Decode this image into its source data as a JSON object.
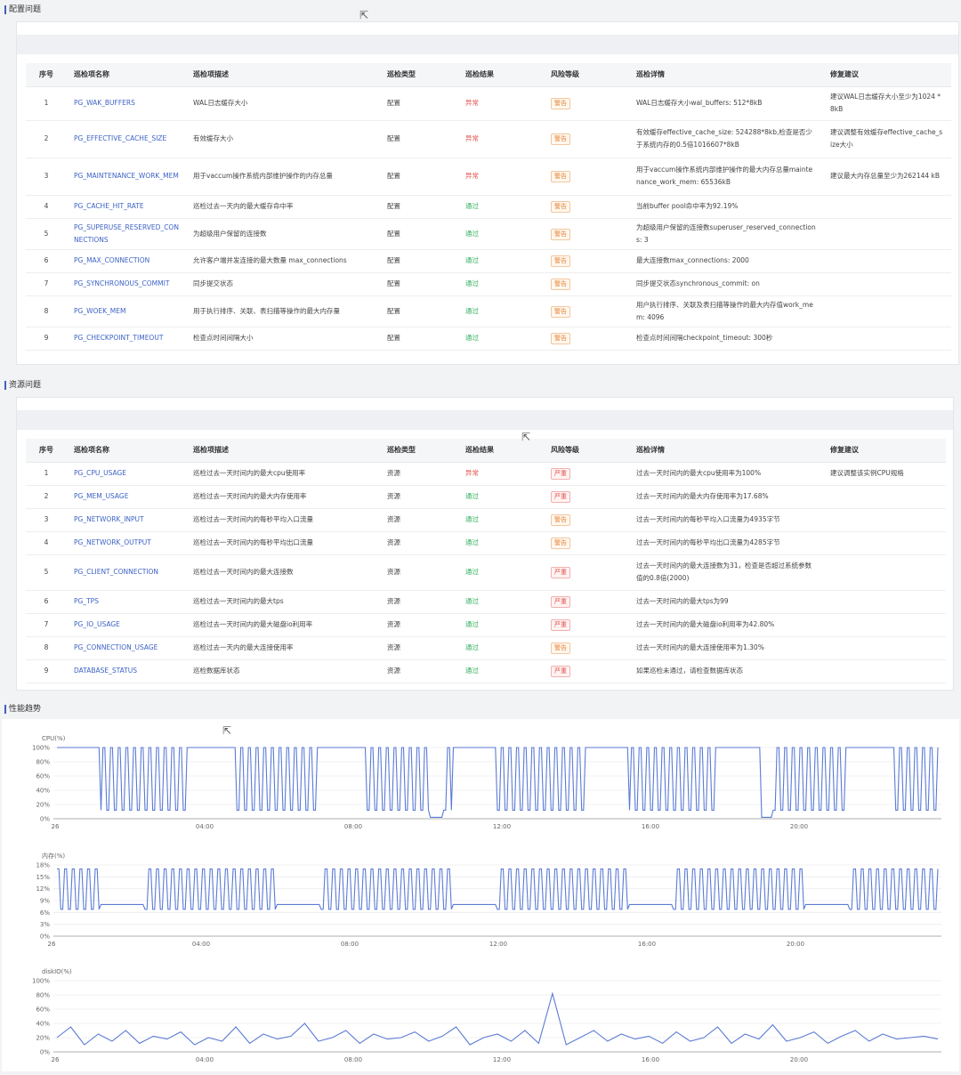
{
  "config_section": {
    "title": "配置问题",
    "headers": [
      "序号",
      "巡检项名称",
      "巡检项描述",
      "巡检类型",
      "巡检结果",
      "风险等级",
      "巡检详情",
      "修复建议"
    ],
    "rows": [
      {
        "no": "1",
        "name": "PG_WAK_BUFFERS",
        "desc": "WAL日志缓存大小",
        "type": "配置",
        "result": "异常",
        "risk": "警告",
        "detail": "WAL日志缓存大小wal_buffers: 512*8kB",
        "fix": "建议WAL日志缓存大小至少为1024 *8kB"
      },
      {
        "no": "2",
        "name": "PG_EFFECTIVE_CACHE_SIZE",
        "desc": "有效缓存大小",
        "type": "配置",
        "result": "异常",
        "risk": "警告",
        "detail": "有效缓存effective_cache_size: 524288*8kb,检查是否少于系统内存的0.5倍1016607*8kB",
        "fix": "建议调整有效缓存effective_cache_size大小"
      },
      {
        "no": "3",
        "name": "PG_MAINTENANCE_WORK_MEM",
        "desc": "用于vaccum操作系统内部维护操作的内存总量",
        "type": "配置",
        "result": "异常",
        "risk": "警告",
        "detail": "用于vaccum操作系统内部维护操作的最大内存总量maintenance_work_mem: 65536kB",
        "fix": "建议最大内存总量至少为262144 kB"
      },
      {
        "no": "4",
        "name": "PG_CACHE_HIT_RATE",
        "desc": "巡检过去一天内的最大缓存命中率",
        "type": "配置",
        "result": "通过",
        "risk": "警告",
        "detail": "当前buffer pool命中率为92.19%",
        "fix": ""
      },
      {
        "no": "5",
        "name": "PG_SUPERUSE_RESERVED_CONNECTIONS",
        "desc": "为超级用户保留的连接数",
        "type": "配置",
        "result": "通过",
        "risk": "警告",
        "detail": "为超级用户保留的连接数superuser_reserved_connections: 3",
        "fix": ""
      },
      {
        "no": "6",
        "name": "PG_MAX_CONNECTION",
        "desc": "允许客户端并发连接的最大数量 max_connections",
        "type": "配置",
        "result": "通过",
        "risk": "警告",
        "detail": "最大连接数max_connections: 2000",
        "fix": ""
      },
      {
        "no": "7",
        "name": "PG_SYNCHRONOUS_COMMIT",
        "desc": "同步提交状态",
        "type": "配置",
        "result": "通过",
        "risk": "警告",
        "detail": "同步提交状态synchronous_commit: on",
        "fix": ""
      },
      {
        "no": "8",
        "name": "PG_WOEK_MEM",
        "desc": "用于执行排序、关联、表扫描等操作的最大内存量",
        "type": "配置",
        "result": "通过",
        "risk": "警告",
        "detail": "用户执行排序、关联及表扫描等操作的最大内存值work_mem: 4096",
        "fix": ""
      },
      {
        "no": "9",
        "name": "PG_CHECKPOINT_TIMEOUT",
        "desc": "检查点时间间隔大小",
        "type": "配置",
        "result": "通过",
        "risk": "警告",
        "detail": "检查点时间间隔checkpoint_timeout: 300秒",
        "fix": ""
      }
    ]
  },
  "resource_section": {
    "title": "资源问题",
    "headers": [
      "序号",
      "巡检项名称",
      "巡检项描述",
      "巡检类型",
      "巡检结果",
      "风险等级",
      "巡检详情",
      "修复建议"
    ],
    "rows": [
      {
        "no": "1",
        "name": "PG_CPU_USAGE",
        "desc": "巡检过去一天时间内的最大cpu使用率",
        "type": "资源",
        "result": "异常",
        "risk": "严重",
        "detail": "过去一天时间内的最大cpu使用率为100%",
        "fix": "建议调整该实例CPU规格"
      },
      {
        "no": "2",
        "name": "PG_MEM_USAGE",
        "desc": "巡检过去一天时间内的最大内存使用率",
        "type": "资源",
        "result": "通过",
        "risk": "严重",
        "detail": "过去一天时间内的最大内存使用率为17.68%",
        "fix": ""
      },
      {
        "no": "3",
        "name": "PG_NETWORK_INPUT",
        "desc": "巡检过去一天时间内的每秒平均入口流量",
        "type": "资源",
        "result": "通过",
        "risk": "警告",
        "detail": "过去一天时间内的每秒平均入口流量为4935字节",
        "fix": ""
      },
      {
        "no": "4",
        "name": "PG_NETWORK_OUTPUT",
        "desc": "巡检过去一天时间内的每秒平均出口流量",
        "type": "资源",
        "result": "通过",
        "risk": "警告",
        "detail": "过去一天时间内的每秒平均出口流量为4285字节",
        "fix": ""
      },
      {
        "no": "5",
        "name": "PG_CLIENT_CONNECTION",
        "desc": "巡检过去一天时间内的最大连接数",
        "type": "资源",
        "result": "通过",
        "risk": "严重",
        "detail": "过去一天时间内的最大连接数为31，检查是否超过系统参数值的0.8倍(2000)",
        "fix": ""
      },
      {
        "no": "6",
        "name": "PG_TPS",
        "desc": "巡检过去一天时间内的最大tps",
        "type": "资源",
        "result": "通过",
        "risk": "严重",
        "detail": "过去一天时间内的最大tps为99",
        "fix": ""
      },
      {
        "no": "7",
        "name": "PG_IO_USAGE",
        "desc": "巡检过去一天时间内的最大磁盘io利用率",
        "type": "资源",
        "result": "通过",
        "risk": "严重",
        "detail": "过去一天时间内的最大磁盘io利用率为42.80%",
        "fix": ""
      },
      {
        "no": "8",
        "name": "PG_CONNECTION_USAGE",
        "desc": "巡检过去一天内的最大连接使用率",
        "type": "资源",
        "result": "通过",
        "risk": "警告",
        "detail": "过去一天时间内的最大连接使用率为1.30%",
        "fix": ""
      },
      {
        "no": "9",
        "name": "DATABASE_STATUS",
        "desc": "巡检数据库状态",
        "type": "资源",
        "result": "通过",
        "risk": "严重",
        "detail": "如果巡检未通过，请检查数据库状态",
        "fix": ""
      }
    ]
  },
  "perf_section": {
    "title": "性能趋势"
  },
  "colors": {
    "accent": "#3d63c5",
    "line": "#5b7bd5",
    "abnormal": "#e0524d",
    "pass": "#2fae5a",
    "warn": "#e6883c"
  },
  "chart_data": [
    {
      "type": "line",
      "ylabel": "CPU(%)",
      "yticks": [
        "0%",
        "20%",
        "40%",
        "60%",
        "80%",
        "100%"
      ],
      "ylim": [
        0,
        100
      ],
      "xticks": [
        "26",
        "04:00",
        "08:00",
        "12:00",
        "16:00",
        "20:00"
      ],
      "pattern": "oscillating between ~10% and 100% in bursts with flat 100% plateaus",
      "series": [
        {
          "values": [
            100,
            100,
            100,
            100,
            100,
            15,
            100,
            20,
            100,
            15,
            100,
            100,
            100,
            100,
            15,
            100,
            20,
            100,
            15,
            100,
            100,
            100,
            100,
            20,
            100,
            15,
            100,
            5,
            100,
            100,
            100,
            100,
            15,
            100,
            20,
            100,
            100,
            100,
            100,
            100,
            15,
            100,
            20,
            100,
            15,
            100,
            100,
            100,
            100,
            20,
            100,
            5,
            100,
            100,
            100,
            100,
            100,
            15,
            100,
            20,
            100,
            100,
            100,
            100,
            100
          ]
        }
      ]
    },
    {
      "type": "line",
      "ylabel": "内存(%)",
      "yticks": [
        "0%",
        "3%",
        "6%",
        "9%",
        "12%",
        "15%",
        "18%"
      ],
      "ylim": [
        0,
        18
      ],
      "xticks": [
        "26",
        "04:00",
        "08:00",
        "12:00",
        "16:00",
        "20:00"
      ],
      "pattern": "oscillating between ~6.5% and ~17%",
      "series": [
        {
          "values": [
            8,
            17,
            7,
            17,
            7,
            17,
            8,
            8,
            17,
            7,
            17,
            7,
            17,
            8,
            8,
            17,
            7,
            17,
            7,
            17,
            7,
            17,
            8,
            8,
            17,
            7,
            17,
            7,
            17,
            8,
            8,
            17,
            7,
            17,
            7,
            17,
            7,
            17,
            8,
            8,
            17,
            7,
            17,
            7,
            17,
            8,
            8,
            17,
            7,
            17,
            7,
            17,
            7,
            17,
            8,
            8,
            17,
            7,
            17,
            7,
            17,
            8,
            17,
            7,
            8
          ]
        }
      ]
    },
    {
      "type": "line",
      "ylabel": "diskIO(%)",
      "yticks": [
        "0%",
        "20%",
        "40%",
        "60%",
        "80%",
        "100%"
      ],
      "ylim": [
        0,
        100
      ],
      "xticks": [
        "26",
        "04:00",
        "08:00",
        "12:00",
        "16:00",
        "20:00"
      ],
      "pattern": "noisy around 15-25% with occasional spikes, one spike near 80% before 12:00",
      "series": [
        {
          "values": [
            20,
            35,
            10,
            25,
            15,
            30,
            12,
            22,
            18,
            28,
            10,
            20,
            15,
            35,
            12,
            25,
            18,
            22,
            40,
            15,
            20,
            30,
            12,
            25,
            18,
            20,
            28,
            15,
            22,
            35,
            10,
            20,
            25,
            15,
            30,
            12,
            82,
            10,
            20,
            30,
            15,
            25,
            18,
            22,
            12,
            28,
            15,
            20,
            35,
            12,
            25,
            18,
            38,
            15,
            20,
            28,
            12,
            22,
            30,
            15,
            25,
            18,
            20,
            22,
            18
          ]
        }
      ]
    }
  ]
}
